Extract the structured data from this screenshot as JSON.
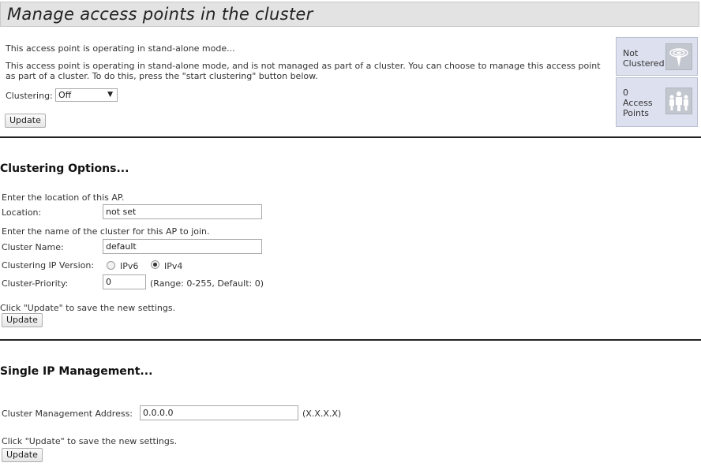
{
  "page": {
    "title": "Manage access points in the cluster"
  },
  "intro": {
    "short_status": "This access point is operating in stand-alone mode...",
    "description": "This access point is operating in stand-alone mode, and is not managed as part of a cluster. You can choose to manage this access point as part of a cluster. To do this, press the \"start clustering\" button below.",
    "clustering_label": "Clustering:",
    "clustering_value": "Off",
    "update_label": "Update"
  },
  "status_panel": {
    "cluster_state": "Not Clustered",
    "cluster_icon": "antenna-icon",
    "ap_count": "0",
    "ap_count_label": "Access Points",
    "ap_icon": "people-icon"
  },
  "clustering_options": {
    "heading": "Clustering Options...",
    "location_hint": "Enter the location of this AP.",
    "location_label": "Location:",
    "location_value": "not set",
    "cluster_name_hint": "Enter the name of the cluster for this AP to join.",
    "cluster_name_label": "Cluster Name:",
    "cluster_name_value": "default",
    "ip_version_label": "Clustering IP Version:",
    "ip_version_options": [
      "IPv6",
      "IPv4"
    ],
    "ip_version_selected": "IPv4",
    "priority_label": "Cluster-Priority:",
    "priority_value": "0",
    "priority_hint": "(Range: 0-255, Default: 0)",
    "save_hint": "Click \"Update\" to save the new settings.",
    "update_label": "Update"
  },
  "single_ip": {
    "heading": "Single IP Management...",
    "address_label": "Cluster Management Address:",
    "address_value": "0.0.0.0",
    "address_format": "(X.X.X.X)",
    "save_hint": "Click \"Update\" to save the new settings.",
    "update_label": "Update"
  }
}
